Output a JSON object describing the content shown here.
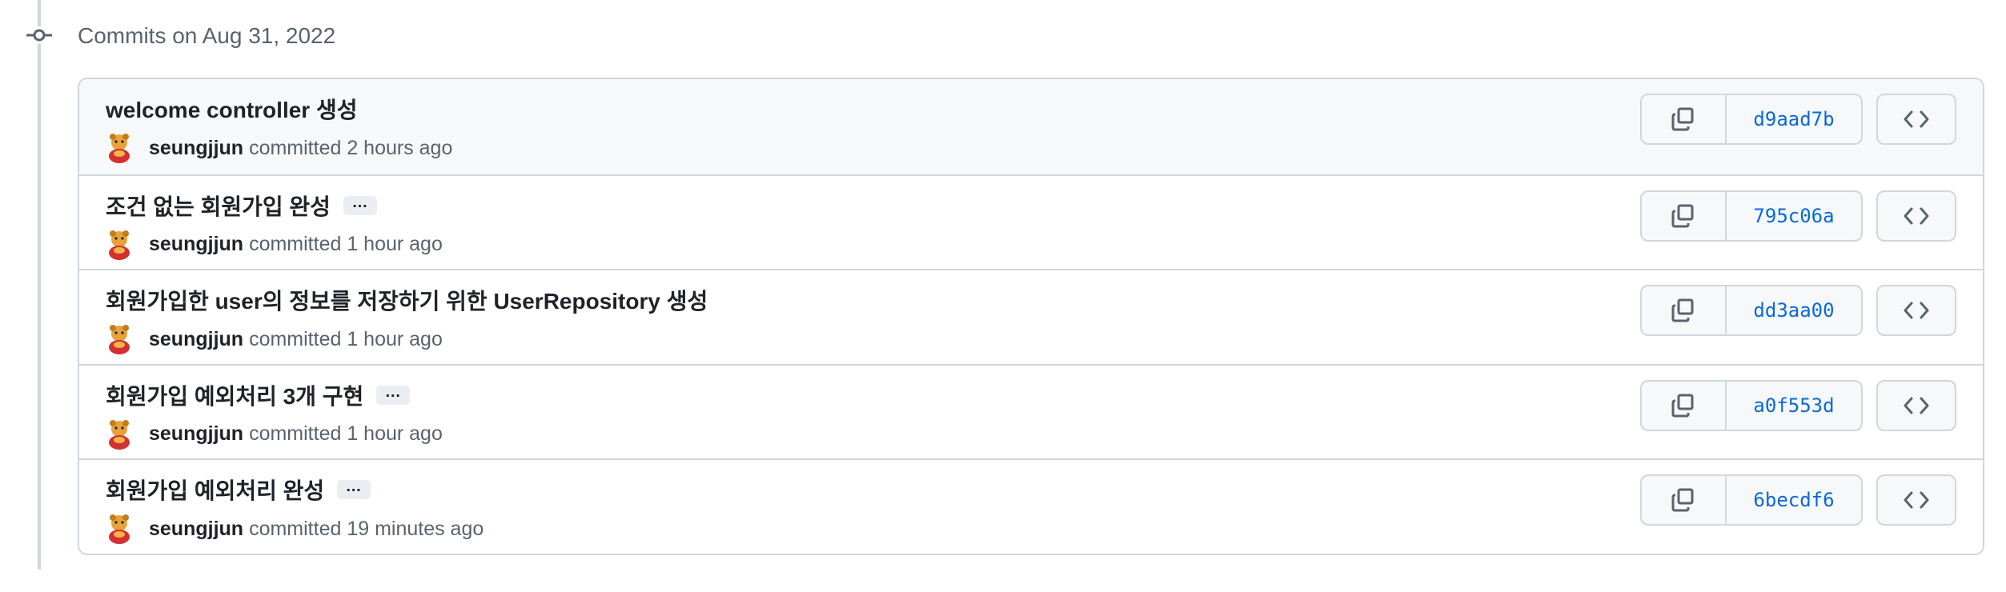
{
  "group": {
    "header": "Commits on Aug 31, 2022",
    "icon": "git-commit-icon"
  },
  "commits": [
    {
      "title": "welcome controller 생성",
      "has_more": false,
      "author": "seungjjun",
      "committed_text": "committed 2 hours ago",
      "sha": "d9aad7b"
    },
    {
      "title": "조건 없는 회원가입 완성",
      "has_more": true,
      "more_label": "…",
      "author": "seungjjun",
      "committed_text": "committed 1 hour ago",
      "sha": "795c06a"
    },
    {
      "title": "회원가입한 user의 정보를 저장하기 위한 UserRepository 생성",
      "has_more": false,
      "author": "seungjjun",
      "committed_text": "committed 1 hour ago",
      "sha": "dd3aa00"
    },
    {
      "title": "회원가입 예외처리 3개 구현",
      "has_more": true,
      "more_label": "…",
      "author": "seungjjun",
      "committed_text": "committed 1 hour ago",
      "sha": "a0f553d"
    },
    {
      "title": "회원가입 예외처리 완성",
      "has_more": true,
      "more_label": "…",
      "author": "seungjjun",
      "committed_text": "committed 19 minutes ago",
      "sha": "6becdf6"
    }
  ],
  "colors": {
    "sha_link": "#0969da",
    "border": "#d0d7de",
    "muted_text": "#59636e",
    "row_highlight": "#f6f8fa"
  }
}
